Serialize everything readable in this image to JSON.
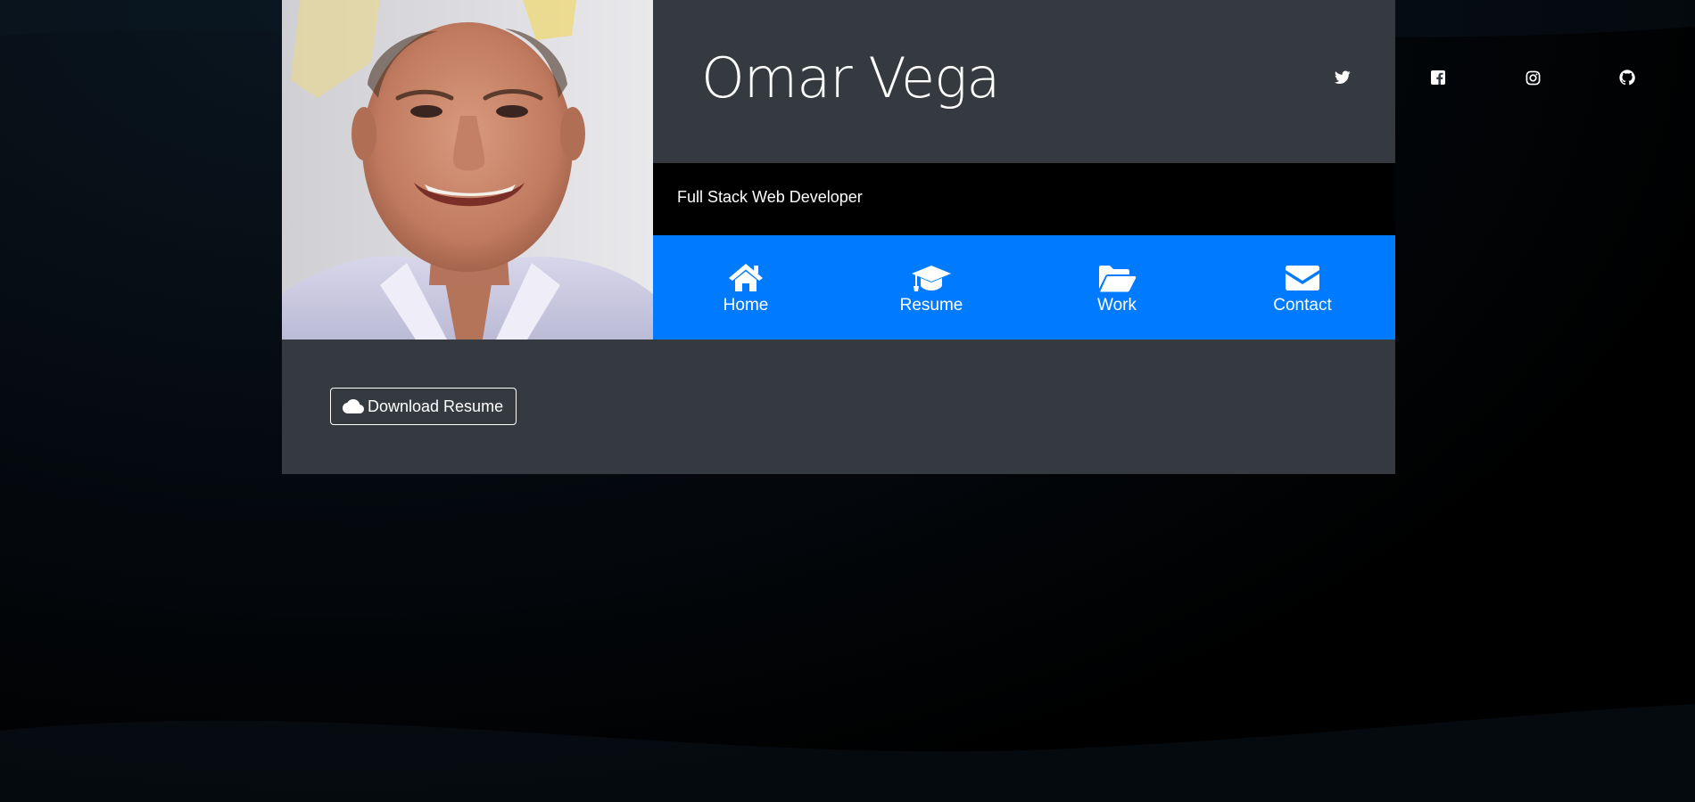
{
  "profile": {
    "name": "Omar Vega",
    "tagline": "Full Stack Web Developer"
  },
  "social": [
    {
      "icon": "twitter-icon"
    },
    {
      "icon": "facebook-icon"
    },
    {
      "icon": "instagram-icon"
    },
    {
      "icon": "github-icon"
    }
  ],
  "nav": {
    "items": [
      {
        "label": "Home",
        "icon": "home-icon"
      },
      {
        "label": "Resume",
        "icon": "graduation-cap-icon"
      },
      {
        "label": "Work",
        "icon": "folder-open-icon"
      },
      {
        "label": "Contact",
        "icon": "envelope-icon"
      }
    ]
  },
  "actions": {
    "download_label": "Download Resume",
    "download_icon": "cloud-icon"
  },
  "colors": {
    "card": "#343a40",
    "nav_accent": "#007bff",
    "tagline_bar": "#000000",
    "text": "#ffffff"
  }
}
